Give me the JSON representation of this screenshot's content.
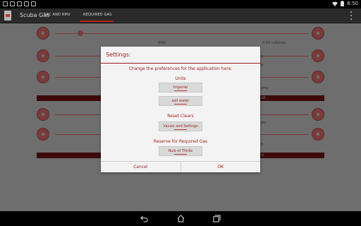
{
  "status_bar": {
    "time": "6:50"
  },
  "action_bar": {
    "title": "Scuba Gas",
    "tabs": [
      {
        "label": "SAC AND RMV"
      },
      {
        "label": "REQUIRED GAS"
      }
    ]
  },
  "background": {
    "rmv_label": "RMV",
    "rmv_value": "0.00 cuft/min",
    "value_fragment": "0",
    "unit_fragment_1": "ft",
    "unit_fragment_2": "pms",
    "unit_fragment_3": "uft",
    "unit_fragment_4": "psi",
    "unit_fragment_5": "ft",
    "unit_fragment_6": "si"
  },
  "dialog": {
    "title": "Settings:",
    "intro": "Change the preferences for the application here:",
    "units_heading": "Units",
    "units_button_1": "Imperial",
    "units_button_2": "salt water",
    "reset_heading": "Reset Clears",
    "reset_button": "Values and Settings",
    "reserve_heading": "Reserve for Required Gas",
    "reserve_button": "Rule of Thirds",
    "cancel_label": "Cancel",
    "ok_label": "OK"
  },
  "colors": {
    "accent": "#9b1b1b",
    "tab_indicator": "#b71c1c"
  }
}
